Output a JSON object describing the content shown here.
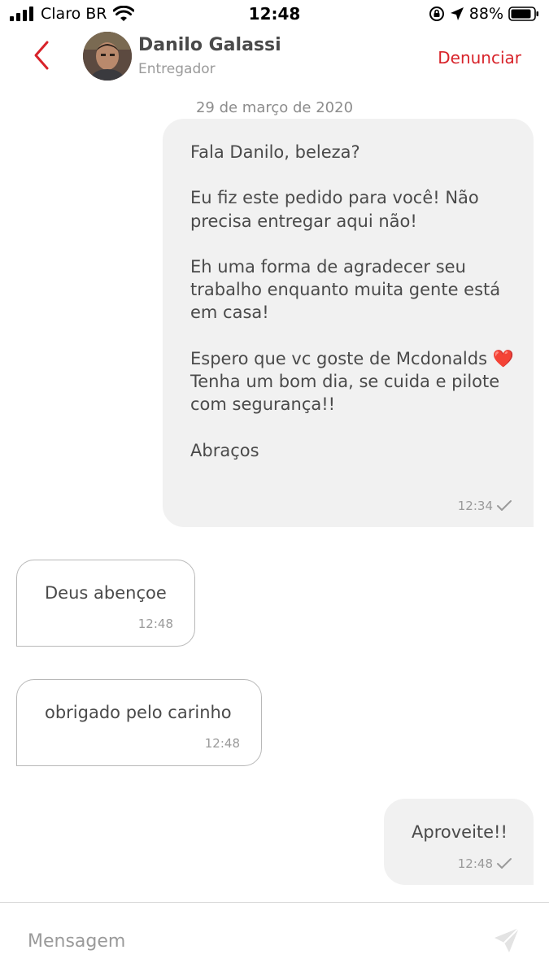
{
  "status_bar": {
    "carrier": "Claro BR",
    "time": "12:48",
    "battery": "88%"
  },
  "header": {
    "contact_name": "Danilo Galassi",
    "contact_role": "Entregador",
    "report_label": "Denunciar"
  },
  "conversation": {
    "date": "29 de março de 2020",
    "messages": [
      {
        "direction": "outgoing",
        "text": "Fala Danilo, beleza?\n\nEu fiz este pedido para você! Não precisa entregar aqui não!\n\nEh uma forma de agradecer seu trabalho enquanto muita gente está em casa!\n\nEspero que vc goste de Mcdonalds ❤️\nTenha um bom dia, se cuida e pilote com segurança!!\n\nAbraços",
        "time": "12:34"
      },
      {
        "direction": "incoming",
        "text": "Deus abençoe",
        "time": "12:48"
      },
      {
        "direction": "incoming",
        "text": "obrigado pelo carinho",
        "time": "12:48"
      },
      {
        "direction": "outgoing",
        "text": "Aproveite!!",
        "time": "12:48"
      }
    ]
  },
  "composer": {
    "placeholder": "Mensagem",
    "value": ""
  },
  "icons": {
    "back": "chevron-left-icon",
    "send": "paper-plane-icon",
    "delivered": "checkmark-icon"
  },
  "colors": {
    "accent": "#d8232a",
    "outgoing_bubble": "#f1f1f1",
    "incoming_border": "#b8b8b8"
  }
}
